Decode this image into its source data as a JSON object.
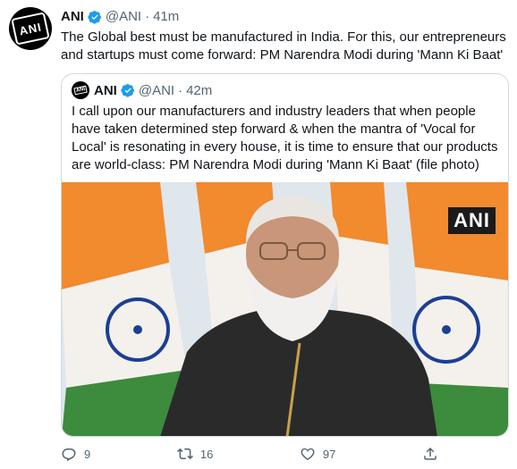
{
  "tweet": {
    "author_name": "ANI",
    "handle": "@ANI",
    "separator": "·",
    "time": "41m",
    "text": "The Global best must be manufactured in India. For this, our entrepreneurs and startups must come forward: PM Narendra Modi during 'Mann Ki Baat'",
    "avatar_logo": "ANI"
  },
  "quoted": {
    "author_name": "ANI",
    "handle": "@ANI",
    "separator": "·",
    "time": "42m",
    "text": "I call upon our manufacturers and industry leaders that when people have taken determined step forward & when the mantra of 'Vocal for Local' is resonating in every house, it is time to ensure that our products are world-class: PM Narendra Modi during 'Mann Ki Baat' (file photo)",
    "watermark": "ANI"
  },
  "actions": {
    "reply_count": "9",
    "retweet_count": "16",
    "like_count": "97"
  },
  "colors": {
    "verified": "#1d9bf0",
    "secondary_text": "#536471",
    "border": "#cfd9de",
    "saffron": "#f28a2e",
    "green": "#3d8b3d",
    "chakra": "#1c3f94"
  },
  "icons": [
    "verified-badge-icon",
    "reply-icon",
    "retweet-icon",
    "like-icon",
    "share-icon"
  ]
}
